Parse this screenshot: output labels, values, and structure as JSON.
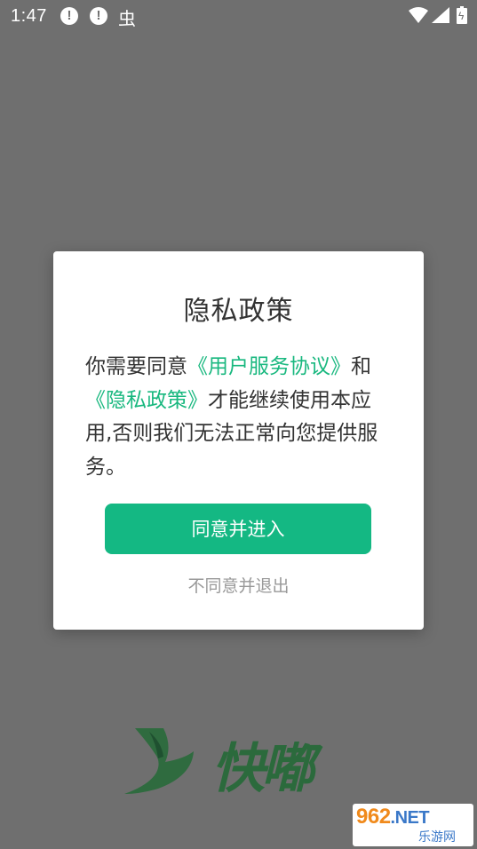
{
  "status_bar": {
    "time": "1:47",
    "notification_1": "!",
    "notification_2": "!",
    "bug_glyph": "虫",
    "icons": [
      "wifi-icon",
      "signal-icon",
      "battery-charging-icon"
    ]
  },
  "dialog": {
    "title": "隐私政策",
    "body_prefix": "你需要同意",
    "link_user_agreement": "《用户服务协议》",
    "body_and": "和",
    "link_privacy_policy": "《隐私政策》",
    "body_suffix": "才能继续使用本应用,否则我们无法正常向您提供服务。",
    "agree_button": "同意并进入",
    "disagree_link": "不同意并退出"
  },
  "splash": {
    "logo_text": "快嘟"
  },
  "watermark": {
    "number": "962",
    "domain": ".NET",
    "subtitle": "乐游网"
  },
  "colors": {
    "accent": "#14b883",
    "overlay": "#6f6f6f",
    "logo": "#2b6a3c"
  }
}
